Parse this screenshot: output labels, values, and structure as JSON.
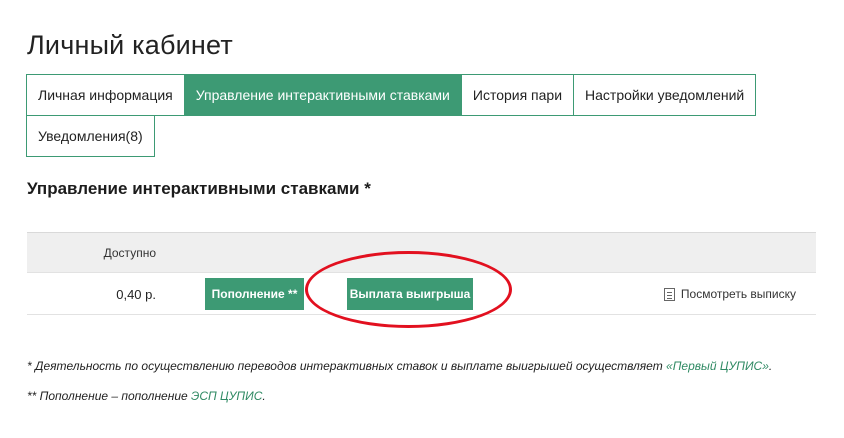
{
  "header": {
    "title": "Личный кабинет"
  },
  "tabs": [
    {
      "label": "Личная информация",
      "active": false
    },
    {
      "label": "Управление интерактивными ставками",
      "active": true
    },
    {
      "label": "История пари",
      "active": false
    },
    {
      "label": "Настройки уведомлений",
      "active": false
    },
    {
      "label": "Уведомления(8)",
      "active": false
    }
  ],
  "section": {
    "title": "Управление интерактивными ставками *"
  },
  "balance": {
    "column_label": "Доступно",
    "amount": "0,40 р.",
    "topup_label": "Пополнение **",
    "payout_label": "Выплата выигрыша",
    "statement_label": "Посмотреть выписку"
  },
  "footnotes": {
    "note1_text": "* Деятельность по осуществлению переводов интерактивных ставок и выплате выигрышей осуществляет ",
    "note1_link": "«Первый ЦУПИС»",
    "note1_end": ".",
    "note2_text": "** Пополнение – пополнение ",
    "note2_link": "ЭСП ЦУПИС",
    "note2_end": "."
  },
  "colors": {
    "accent": "#3d9a74",
    "highlight": "#e2101f",
    "link": "#2f8a63"
  }
}
